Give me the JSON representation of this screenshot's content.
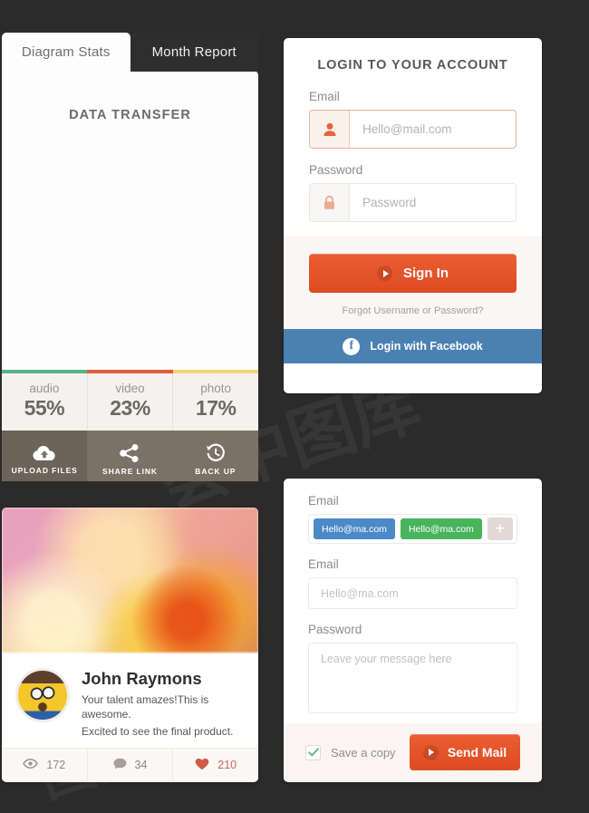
{
  "transfer_card": {
    "tabs": [
      {
        "label": "Diagram Stats",
        "active": true
      },
      {
        "label": "Month Report",
        "active": false
      }
    ],
    "title": "DATA TRANSFER",
    "stats": [
      {
        "label": "audio",
        "value": "55%",
        "percent": 55,
        "color": "#58b08a"
      },
      {
        "label": "video",
        "value": "23%",
        "percent": 23,
        "color": "#e35b3f"
      },
      {
        "label": "photo",
        "value": "17%",
        "percent": 17,
        "color": "#f2d675"
      }
    ],
    "actions": [
      {
        "label": "UPLOAD FILES",
        "icon": "cloud-upload-icon"
      },
      {
        "label": "SHARE LINK",
        "icon": "share-icon"
      },
      {
        "label": "BACK UP",
        "icon": "clock-rewind-icon"
      }
    ]
  },
  "login_card": {
    "title": "LOGIN TO YOUR ACCOUNT",
    "email": {
      "label": "Email",
      "placeholder": "Hello@mail.com",
      "value": "",
      "icon": "user-icon"
    },
    "password": {
      "label": "Password",
      "placeholder": "Password",
      "value": "",
      "icon": "lock-icon"
    },
    "sign_in_label": "Sign In",
    "forgot_label": "Forgot Username or Password?",
    "facebook_label": "Login with Facebook",
    "accent_color": "#e4522a",
    "facebook_color": "#4b81b2"
  },
  "profile_card": {
    "image_alt": "autumn-leaves-photo",
    "name": "John Raymons",
    "message_line1": "Your talent amazes!This is awesome.",
    "message_line2": "Excited to see the final product.",
    "meta": [
      {
        "icon": "eye-icon",
        "value": "172"
      },
      {
        "icon": "comment-icon",
        "value": "34"
      },
      {
        "icon": "heart-icon",
        "value": "210"
      }
    ]
  },
  "mail_card": {
    "tag_field_label": "Email",
    "tags": [
      {
        "text": "Hello@ma.com",
        "color": "#4b8ac6"
      },
      {
        "text": "Hello@ma.com",
        "color": "#48b45c"
      }
    ],
    "add_tag_label": "+",
    "email_label": "Email",
    "email_placeholder": "Hello@ma.com",
    "email_value": "",
    "message_label": "Password",
    "message_placeholder": "Leave your message here",
    "message_value": "",
    "save_copy_label": "Save a copy",
    "save_copy_checked": true,
    "send_label": "Send Mail"
  },
  "watermarks": [
    "荟",
    "图库",
    "荟中图库",
    "图库",
    "荟中",
    "图库"
  ]
}
